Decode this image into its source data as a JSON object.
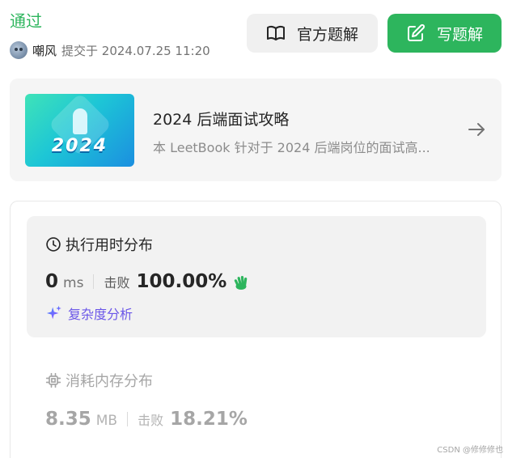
{
  "header": {
    "status": "通过",
    "user_name": "嘲风",
    "submit_text": "提交于 2024.07.25 11:20"
  },
  "actions": {
    "official_solution_label": "官方题解",
    "official_solution_icon": "book-open-icon",
    "write_solution_label": "写题解",
    "write_solution_icon": "edit-icon"
  },
  "book": {
    "cover_text": "2024",
    "title": "2024 后端面试攻略",
    "description": "本 LeetBook 针对于 2024 后端岗位的面试高..."
  },
  "runtime": {
    "title": "执行用时分布",
    "value": "0",
    "unit": "ms",
    "beat_label": "击败",
    "beat_percent": "100.00%",
    "complexity_label": "复杂度分析"
  },
  "memory": {
    "title": "消耗内存分布",
    "value": "8.35",
    "unit": "MB",
    "beat_label": "击败",
    "beat_percent": "18.21%"
  },
  "watermark": "CSDN @修修修也",
  "colors": {
    "accent_green": "#2db55d",
    "complexity_purple": "#6b57e8"
  }
}
